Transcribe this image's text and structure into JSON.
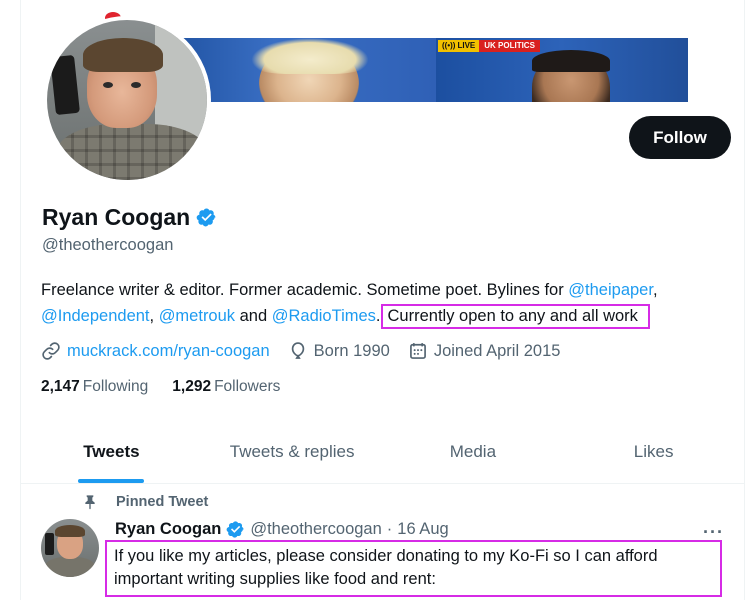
{
  "banner": {
    "live_label": "LIVE",
    "section_label": "UK POLITICS"
  },
  "profile": {
    "follow_label": "Follow",
    "display_name": "Ryan Coogan",
    "handle": "@theothercoogan",
    "bio": {
      "text1": "Freelance writer & editor. Former academic. Sometime poet. Bylines for ",
      "mention1": "@theipaper",
      "sep1": ",",
      "mention2": "@Independent",
      "sep2": ", ",
      "mention3": "@metrouk",
      "sep3": " and ",
      "mention4": "@RadioTimes",
      "sep4": ".",
      "highlight": "Currently open to any and all work"
    },
    "website": "muckrack.com/ryan-coogan",
    "born": "Born 1990",
    "joined": "Joined April 2015",
    "following_count": "2,147",
    "following_label": "Following",
    "followers_count": "1,292",
    "followers_label": "Followers"
  },
  "tabs": [
    {
      "label": "Tweets",
      "active": true
    },
    {
      "label": "Tweets & replies",
      "active": false
    },
    {
      "label": "Media",
      "active": false
    },
    {
      "label": "Likes",
      "active": false
    }
  ],
  "tweet": {
    "pinned_label": "Pinned Tweet",
    "name": "Ryan Coogan",
    "handle": "@theothercoogan",
    "dot": "·",
    "date": "16 Aug",
    "more": "···",
    "text": "If you like my articles, please consider donating to my Ko-Fi so I can afford important writing supplies like food and rent:"
  },
  "colors": {
    "accent": "#1d9bf0",
    "highlight_outline": "#d62be6",
    "text_primary": "#0f1419",
    "text_secondary": "#536471",
    "follow_bg": "#0f1419"
  },
  "icons": {
    "verified": "verified-badge-icon",
    "link": "link-icon",
    "born": "balloon-icon",
    "joined": "calendar-icon",
    "pinned": "pin-icon",
    "more": "more-icon"
  }
}
